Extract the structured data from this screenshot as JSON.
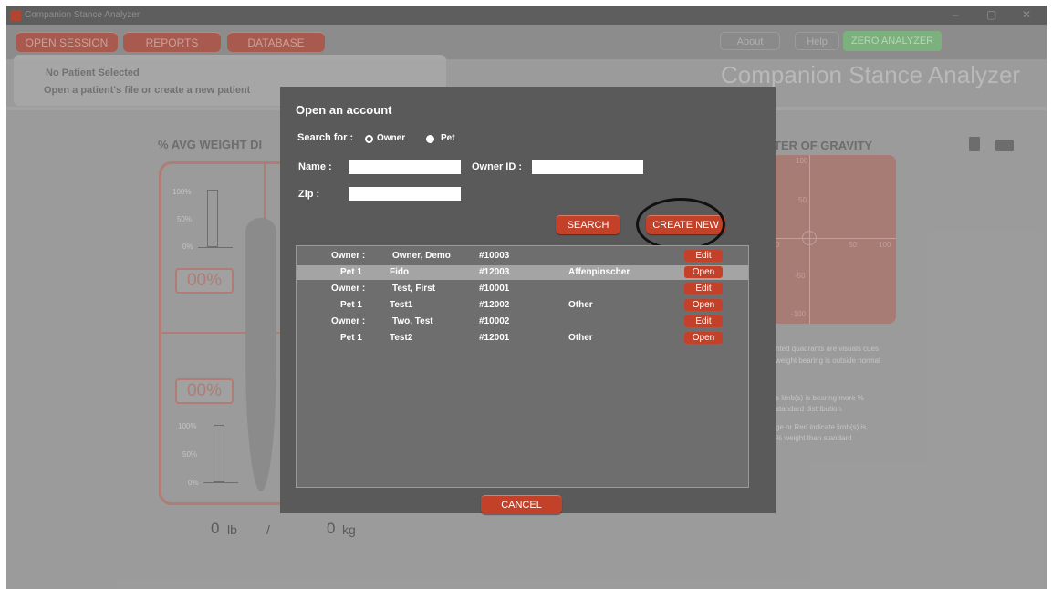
{
  "window": {
    "title": "Companion Stance Analyzer",
    "controls": [
      "–",
      "▢",
      "✕"
    ]
  },
  "nav": {
    "open_session": "OPEN SESSION",
    "reports": "REPORTS",
    "database": "DATABASE",
    "about": "About",
    "help": "Help",
    "zero_analyzer": "ZERO ANALYZER"
  },
  "background": {
    "patient_line1": "No Patient Selected",
    "patient_line2": "Open a patient's file or create a new patient",
    "app_title": "Companion Stance Analyzer",
    "weight_heading": "% AVG WEIGHT DI",
    "cog_heading": "TER OF GRAVITY",
    "pct_top": "00%",
    "pct_bottom": "00%",
    "axis_top": [
      "100%",
      "50%",
      "0%"
    ],
    "axis_bottom": [
      "100%",
      "50%",
      "0%"
    ],
    "weight_lb_value": "0",
    "weight_lb_unit": "lb",
    "separator": "/",
    "weight_kg_value": "0",
    "weight_kg_unit": "kg",
    "cog_labels": {
      "top": "100",
      "upper": "50",
      "left": "0",
      "mid": "50",
      "right": "100",
      "lower": "-50",
      "bottom": "-100"
    },
    "notes": [
      "nted quadrants are visuals cues",
      "weight bearing is outside normal",
      "s limb(s) is bearing more %",
      "standard distribution.",
      "ge or Red indicate limb(s) is",
      "% weight than standard"
    ]
  },
  "dialog": {
    "title": "Open an account",
    "search_for_label": "Search for :",
    "owner_option": "Owner",
    "pet_option": "Pet",
    "name_label": "Name :",
    "name_value": "",
    "owner_id_label": "Owner ID :",
    "owner_id_value": "",
    "zip_label": "Zip :",
    "zip_value": "",
    "search_button": "SEARCH",
    "create_new_button": "CREATE NEW",
    "cancel_button": "CANCEL",
    "results": [
      {
        "col1": "Owner :",
        "col2": "Owner, Demo",
        "col3": "#10003",
        "col4": "",
        "action": "Edit",
        "selected": false
      },
      {
        "col1": "Pet 1",
        "col2": "Fido",
        "col3": "#12003",
        "col4": "Affenpinscher",
        "action": "Open",
        "selected": true
      },
      {
        "col1": "Owner :",
        "col2": "Test, First",
        "col3": "#10001",
        "col4": "",
        "action": "Edit",
        "selected": false
      },
      {
        "col1": "Pet 1",
        "col2": "Test1",
        "col3": "#12002",
        "col4": "Other",
        "action": "Open",
        "selected": false
      },
      {
        "col1": "Owner :",
        "col2": "Two, Test",
        "col3": "#10002",
        "col4": "",
        "action": "Edit",
        "selected": false
      },
      {
        "col1": "Pet 1",
        "col2": "Test2",
        "col3": "#12001",
        "col4": "Other",
        "action": "Open",
        "selected": false
      }
    ]
  },
  "colors": {
    "accent_red": "#c24128",
    "dialog_bg": "#5a5a5a",
    "zero_green": "#7cb07c"
  }
}
